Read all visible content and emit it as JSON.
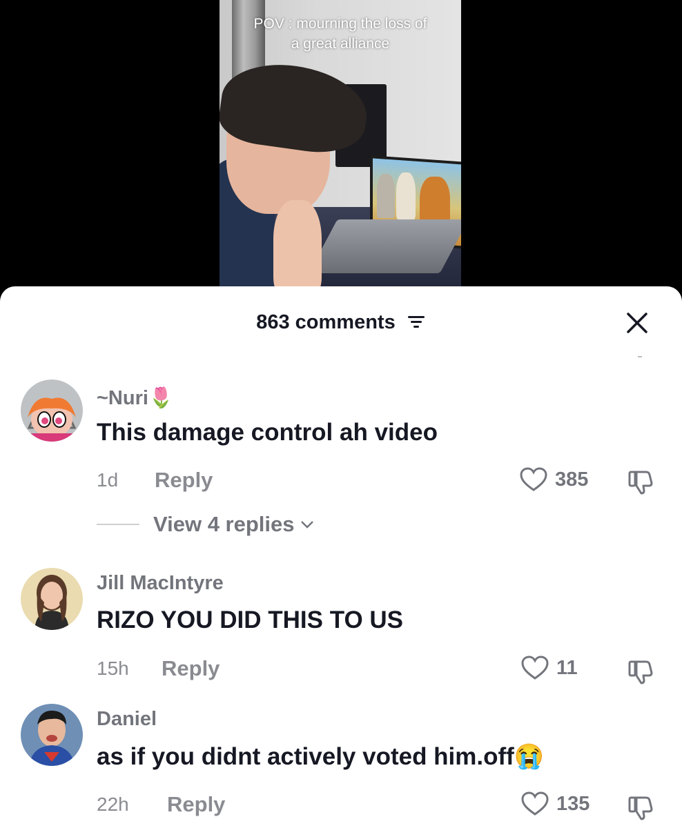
{
  "video": {
    "caption_line1": "POV : mourning the loss of",
    "caption_line2": "a great alliance"
  },
  "comments_panel": {
    "count_label": "863 comments",
    "filter_icon": "filter-icon",
    "close_icon": "close-icon"
  },
  "comments": [
    {
      "username": "~Nuri",
      "username_emoji": "🌷",
      "text": "This damage control ah video",
      "time": "1d",
      "reply_label": "Reply",
      "likes": "385",
      "view_replies": "View 4 replies"
    },
    {
      "username": "Jill MacIntyre",
      "text": "RIZO YOU DID THIS TO US",
      "time": "15h",
      "reply_label": "Reply",
      "likes": "11"
    },
    {
      "username": "Daniel",
      "text": "as if you didnt actively voted him.off",
      "text_emoji": "😭",
      "time": "22h",
      "reply_label": "Reply",
      "likes": "135"
    }
  ],
  "colors": {
    "primary_text": "#161823",
    "secondary_text": "#73757c",
    "sheet_background": "#ffffff",
    "page_background": "#000000"
  }
}
